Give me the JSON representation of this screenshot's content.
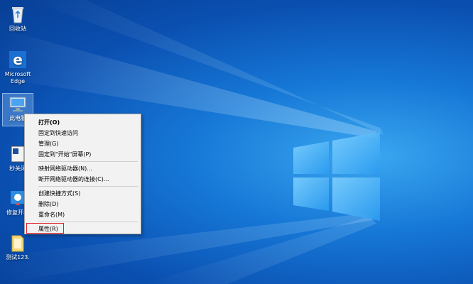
{
  "desktop": {
    "icons": [
      {
        "label": "回收站",
        "icon": "recycle-bin-icon"
      },
      {
        "label": "Microsoft\nEdge",
        "icon": "edge-icon"
      },
      {
        "label": "此电脑",
        "icon": "computer-icon"
      },
      {
        "label": "秒关闭",
        "icon": "app-icon"
      },
      {
        "label": "修复开机",
        "icon": "repair-icon"
      },
      {
        "label": "测试123.",
        "icon": "folder-icon"
      }
    ]
  },
  "context_menu": {
    "open": "打开(O)",
    "pin_quick": "固定到快速访问",
    "manage": "管理(G)",
    "pin_start": "固定到\"开始\"屏幕(P)",
    "map_drive": "映射网络驱动器(N)...",
    "disconnect": "断开网络驱动器的连接(C)...",
    "create_shortcut": "创建快捷方式(S)",
    "delete": "删除(D)",
    "rename": "重命名(M)",
    "properties": "属性(R)"
  },
  "colors": {
    "highlight": "#e0202a"
  }
}
